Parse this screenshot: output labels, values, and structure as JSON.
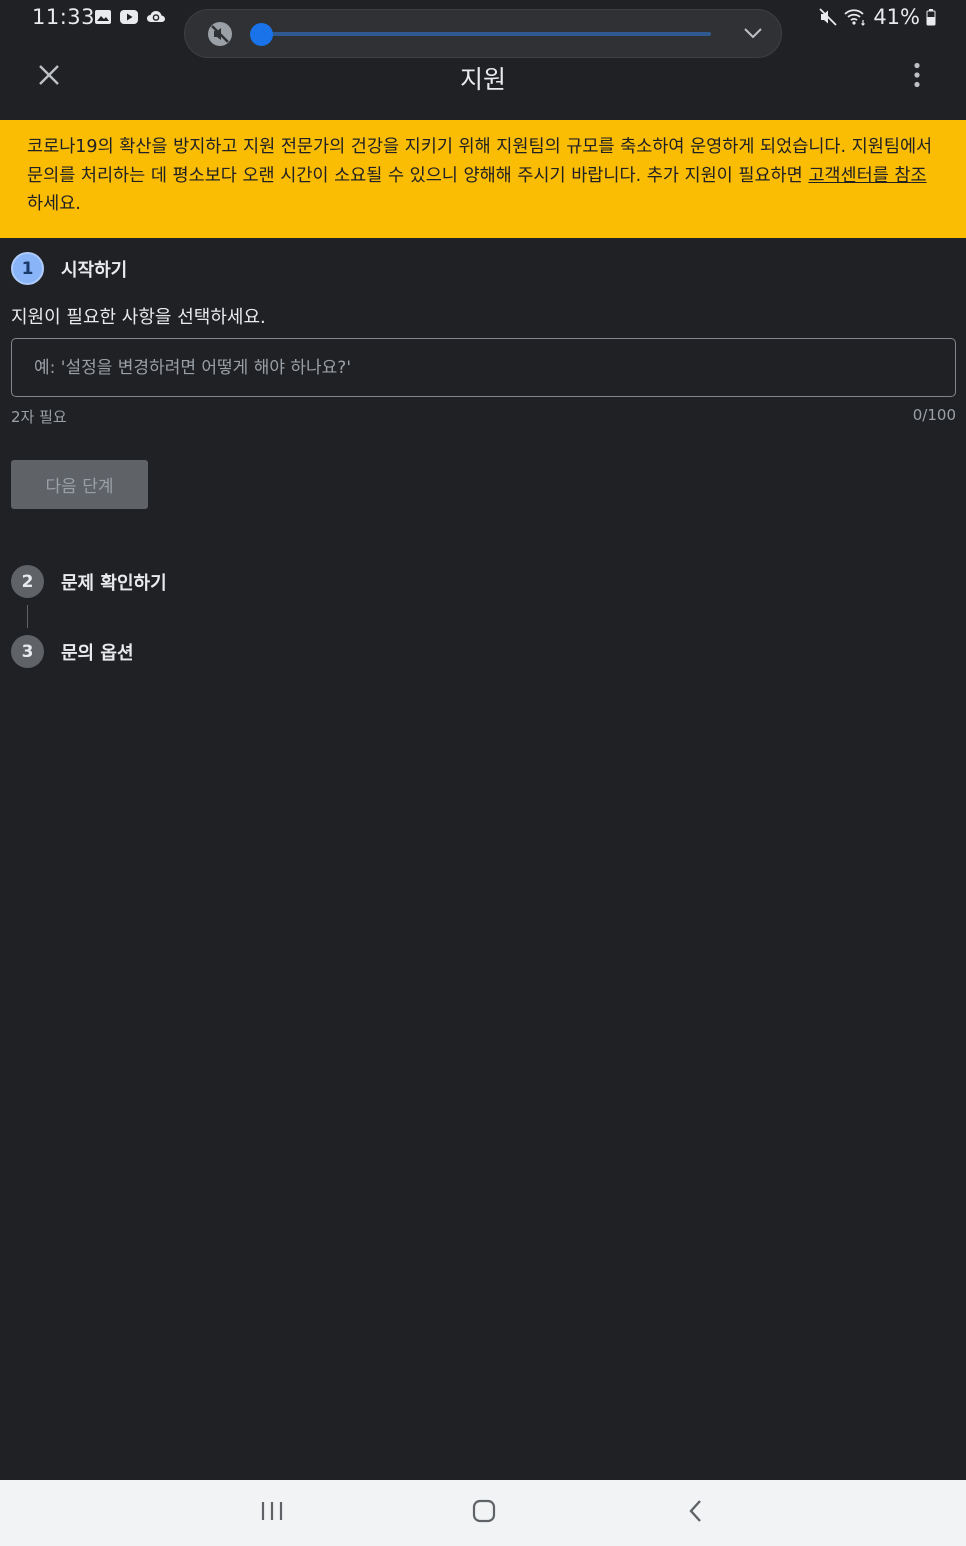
{
  "status_bar": {
    "time": "11:33",
    "battery_text": "41%",
    "notification_icons": [
      "gallery-icon",
      "youtube-icon",
      "cloud-sync-icon"
    ],
    "right_icons": [
      "mute-icon",
      "wifi-icon",
      "battery-icon"
    ]
  },
  "volume_panel": {
    "level": 0,
    "accent_color": "#1a73e8",
    "icons": [
      "muted-speaker-icon",
      "chevron-down-icon"
    ]
  },
  "app_bar": {
    "title": "지원",
    "icons": [
      "close-icon",
      "more-vert-icon"
    ]
  },
  "banner": {
    "text": "코로나19의 확산을 방지하고 지원 전문가의 건강을 지키기 위해 지원팀의 규모를 축소하여 운영하게 되었습니다. 지원팀에서 문의를 처리하는 데 평소보다 오랜 시간이 소요될 수 있으니 양해해 주시기 바랍니다. 추가 지원이 필요하면 ",
    "link_text": "고객센터를 참조",
    "suffix": "하세요.",
    "background_color": "#fbbc04"
  },
  "steps": [
    {
      "number": "1",
      "title": "시작하기",
      "active": true
    },
    {
      "number": "2",
      "title": "문제 확인하기",
      "active": false
    },
    {
      "number": "3",
      "title": "문의 옵션",
      "active": false
    }
  ],
  "form": {
    "instruction": "지원이 필요한 사항을 선택하세요.",
    "placeholder": "예: '설정을 변경하려면 어떻게 해야 하나요?'",
    "value": "",
    "helper": "2자 필요",
    "counter": "0/100",
    "next_label": "다음 단계"
  },
  "nav_bar": {
    "icons": [
      "recent-apps-icon",
      "home-icon",
      "back-icon"
    ]
  }
}
